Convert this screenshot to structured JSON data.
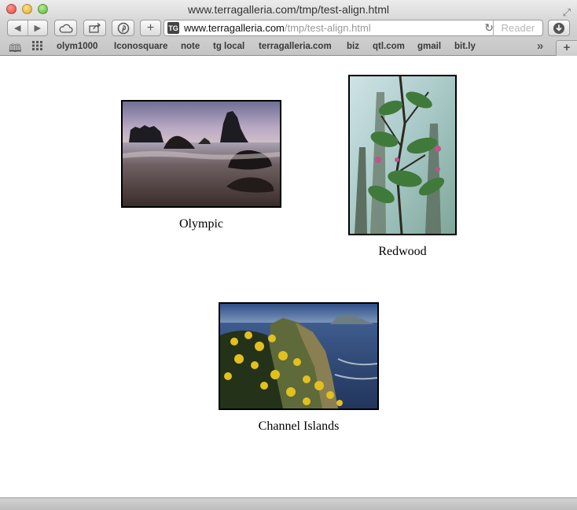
{
  "window": {
    "title": "www.terragalleria.com/tmp/test-align.html"
  },
  "toolbar": {
    "back_icon": "back-arrow-icon",
    "forward_icon": "forward-arrow-icon",
    "icloud_icon": "cloud-icon",
    "share_icon": "share-icon",
    "pin_icon": "pinterest-icon",
    "add_label": "+",
    "favicon_text": "TG",
    "url_host": "www.terragalleria.com",
    "url_path": "/tmp/test-align.html",
    "reader_label": "Reader"
  },
  "bookmarks": {
    "items": [
      "olym1000",
      "Iconosquare",
      "note",
      "tg local",
      "terragalleria.com",
      "biz",
      "qtl.com",
      "gmail",
      "bit.ly"
    ]
  },
  "page": {
    "images": [
      {
        "caption": "Olympic"
      },
      {
        "caption": "Redwood"
      },
      {
        "caption": "Channel Islands"
      }
    ]
  }
}
